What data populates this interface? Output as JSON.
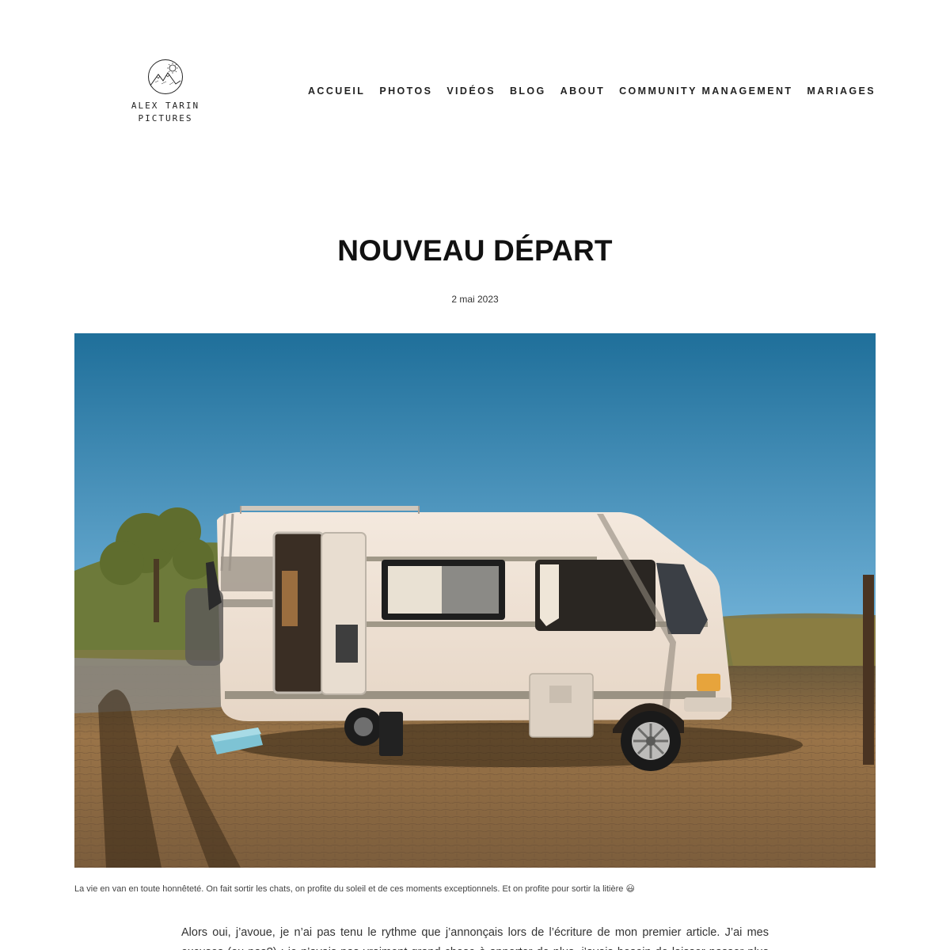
{
  "header": {
    "logo": {
      "line1": "ALEX TARIN",
      "line2": "PICTURES",
      "icon": "mountain-sun-icon"
    },
    "nav": [
      {
        "label": "ACCUEIL"
      },
      {
        "label": "PHOTOS"
      },
      {
        "label": "VIDÉOS"
      },
      {
        "label": "BLOG"
      },
      {
        "label": "ABOUT"
      },
      {
        "label": "COMMUNITY MANAGEMENT"
      },
      {
        "label": "MARIAGES"
      }
    ]
  },
  "article": {
    "title": "NOUVEAU DÉPART",
    "date": "2 mai 2023",
    "image_caption": "La vie en van en toute honnêteté. On fait sortir les chats, on profite du soleil et de ces moments exceptionnels. Et on profite pour sortir la litière 😃",
    "body_start": "Alors oui, j’avoue, je n’ai pas tenu le rythme que j’annonçais lors de l’écriture de mon premier article. J’ai mes excuses (ou pas?) : je n’avais pas vraiment grand chose à apporter de plus, j’avais besoin de laisser passer plus de temps, de"
  },
  "colors": {
    "sky_top": "#1f6f9a",
    "sky_bottom": "#8cc3e0",
    "van_body": "#f1e7dc",
    "ground": "#8a6a45"
  }
}
